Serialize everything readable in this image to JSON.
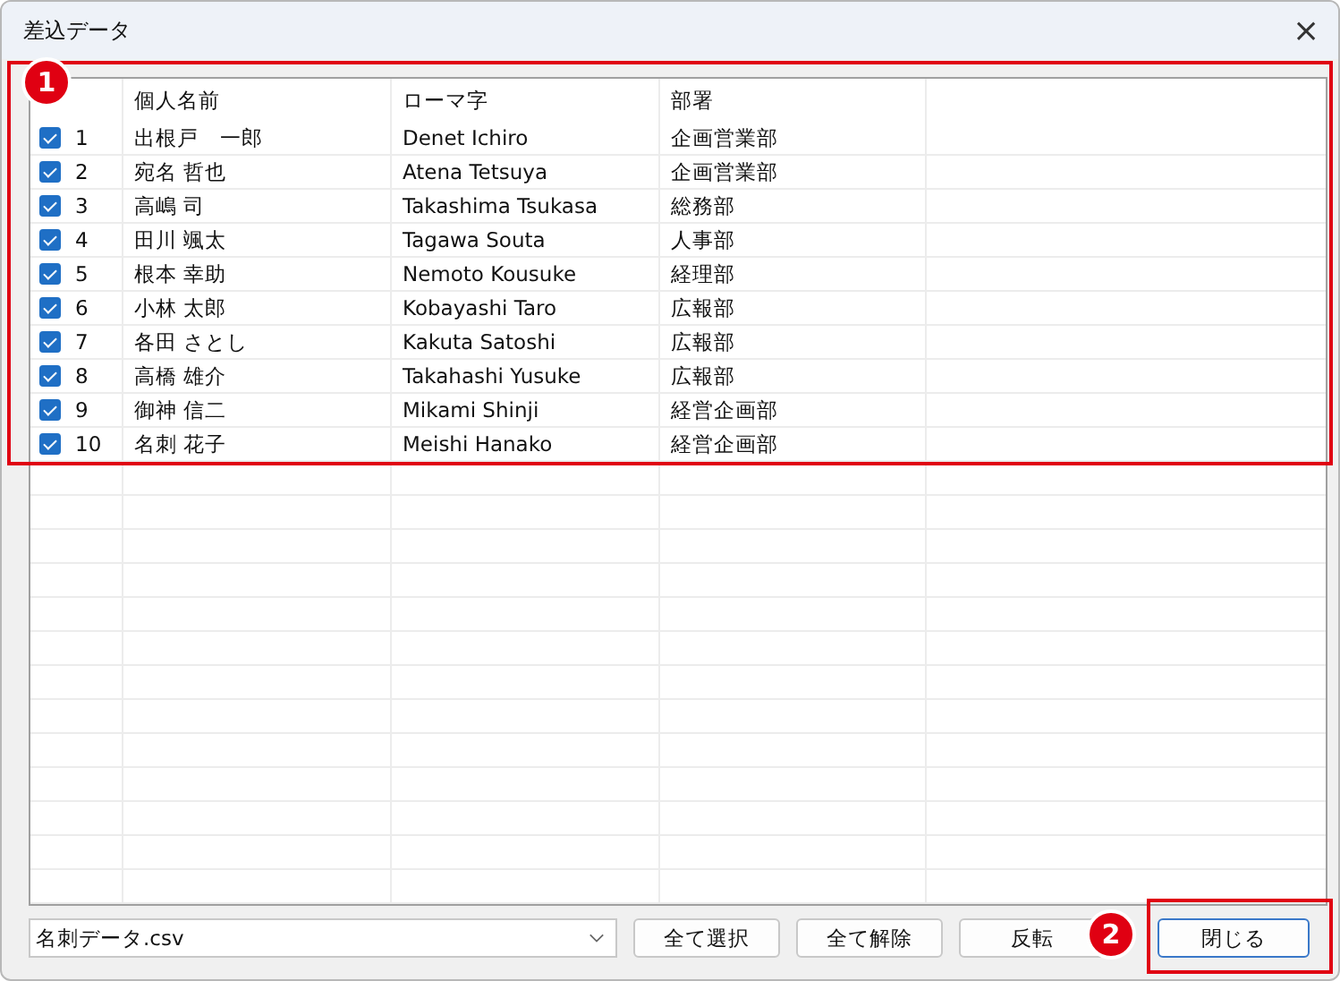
{
  "window": {
    "title": "差込データ",
    "close": "×"
  },
  "table": {
    "columns": [
      "個人名前",
      "ローマ字",
      "部署"
    ],
    "rows": [
      {
        "checked": true,
        "no": "1",
        "name": "出根戸　一郎",
        "romaji": "Denet Ichiro",
        "dept": "企画営業部"
      },
      {
        "checked": true,
        "no": "2",
        "name": "宛名 哲也",
        "romaji": "Atena Tetsuya",
        "dept": "企画営業部"
      },
      {
        "checked": true,
        "no": "3",
        "name": "高嶋 司",
        "romaji": "Takashima Tsukasa",
        "dept": "総務部"
      },
      {
        "checked": true,
        "no": "4",
        "name": "田川 颯太",
        "romaji": "Tagawa Souta",
        "dept": "人事部"
      },
      {
        "checked": true,
        "no": "5",
        "name": "根本 幸助",
        "romaji": "Nemoto Kousuke",
        "dept": "経理部"
      },
      {
        "checked": true,
        "no": "6",
        "name": "小林 太郎",
        "romaji": "Kobayashi Taro",
        "dept": "広報部"
      },
      {
        "checked": true,
        "no": "7",
        "name": "各田 さとし",
        "romaji": "Kakuta Satoshi",
        "dept": "広報部"
      },
      {
        "checked": true,
        "no": "8",
        "name": "高橋 雄介",
        "romaji": "Takahashi Yusuke",
        "dept": "広報部"
      },
      {
        "checked": true,
        "no": "9",
        "name": "御神 信二",
        "romaji": "Mikami Shinji",
        "dept": "経営企画部"
      },
      {
        "checked": true,
        "no": "10",
        "name": "名刺 花子",
        "romaji": "Meishi Hanako",
        "dept": "経営企画部"
      }
    ]
  },
  "file_select": {
    "value": "名刺データ.csv"
  },
  "buttons": [
    {
      "label": "全て選択",
      "kind": "normal"
    },
    {
      "label": "全て解除",
      "kind": "normal"
    },
    {
      "label": "反転",
      "kind": "normal"
    },
    {
      "label": "閉じる",
      "kind": "default"
    }
  ],
  "callouts": [
    {
      "number": "1"
    },
    {
      "number": "2"
    }
  ]
}
